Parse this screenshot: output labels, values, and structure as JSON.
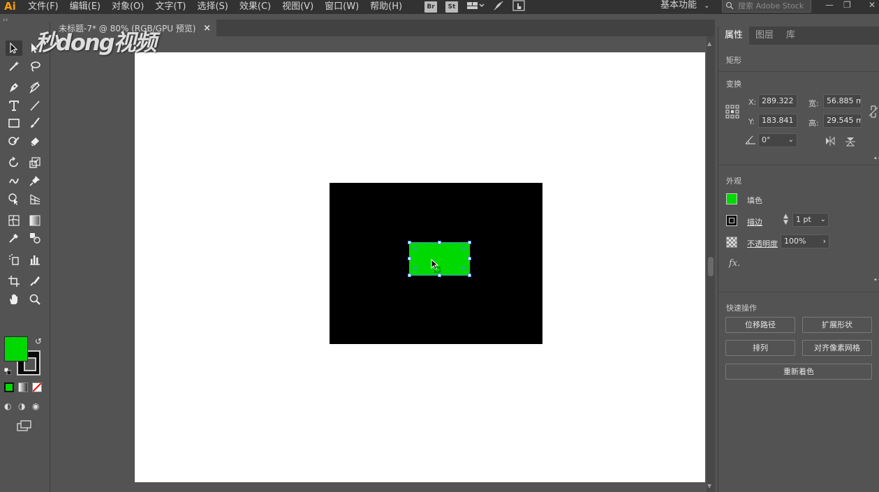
{
  "app": {
    "logo": "Ai",
    "menu": [
      "文件(F)",
      "编辑(E)",
      "对象(O)",
      "文字(T)",
      "选择(S)",
      "效果(C)",
      "视图(V)",
      "窗口(W)",
      "帮助(H)"
    ],
    "bridge_label": "Br",
    "stock_label": "St",
    "workspace_label": "基本功能",
    "stock_search_placeholder": "搜索 Adobe Stock"
  },
  "watermark": "秒dong视频",
  "document_tab": {
    "title": "未标题-7* @ 80% (RGB/GPU 预览)",
    "close": "×"
  },
  "colors": {
    "fill": "#00d900",
    "stroke": "#000000",
    "artboard": "#ffffff",
    "black_rect": "#000000",
    "selection": "#4a90e2"
  },
  "tools": [
    "selection-tool",
    "direct-selection-tool",
    "magic-wand-tool",
    "lasso-tool",
    "pen-tool",
    "curvature-tool",
    "type-tool",
    "line-tool",
    "rectangle-tool",
    "paintbrush-tool",
    "shaper-tool",
    "eraser-tool",
    "rotate-tool",
    "scale-tool",
    "warp-tool",
    "puppet-warp-tool",
    "shape-builder-tool",
    "perspective-grid-tool",
    "mesh-tool",
    "gradient-tool",
    "eyedropper-tool",
    "blend-tool",
    "symbol-sprayer-tool",
    "column-graph-tool",
    "artboard-tool",
    "slice-tool",
    "hand-tool",
    "zoom-tool"
  ],
  "panel": {
    "tabs": [
      "属性",
      "图层",
      "库"
    ],
    "object_type": "矩形",
    "transform": {
      "title": "变换",
      "x_label": "X:",
      "x_value": "289.322",
      "y_label": "Y:",
      "y_value": "183.841",
      "w_label": "宽:",
      "w_value": "56.885 m",
      "h_label": "高:",
      "h_value": "29.545 m",
      "angle_value": "0°"
    },
    "appearance": {
      "title": "外观",
      "fill_label": "填色",
      "stroke_label": "描边",
      "stroke_value": "1 pt",
      "opacity_label": "不透明度",
      "opacity_value": "100%",
      "fx_label": "fx."
    },
    "quick_actions": {
      "title": "快速操作",
      "offset_path": "位移路径",
      "expand_shape": "扩展形状",
      "arrange": "排列",
      "align_pixel_grid": "对齐像素网格",
      "recolor": "重新着色"
    }
  }
}
